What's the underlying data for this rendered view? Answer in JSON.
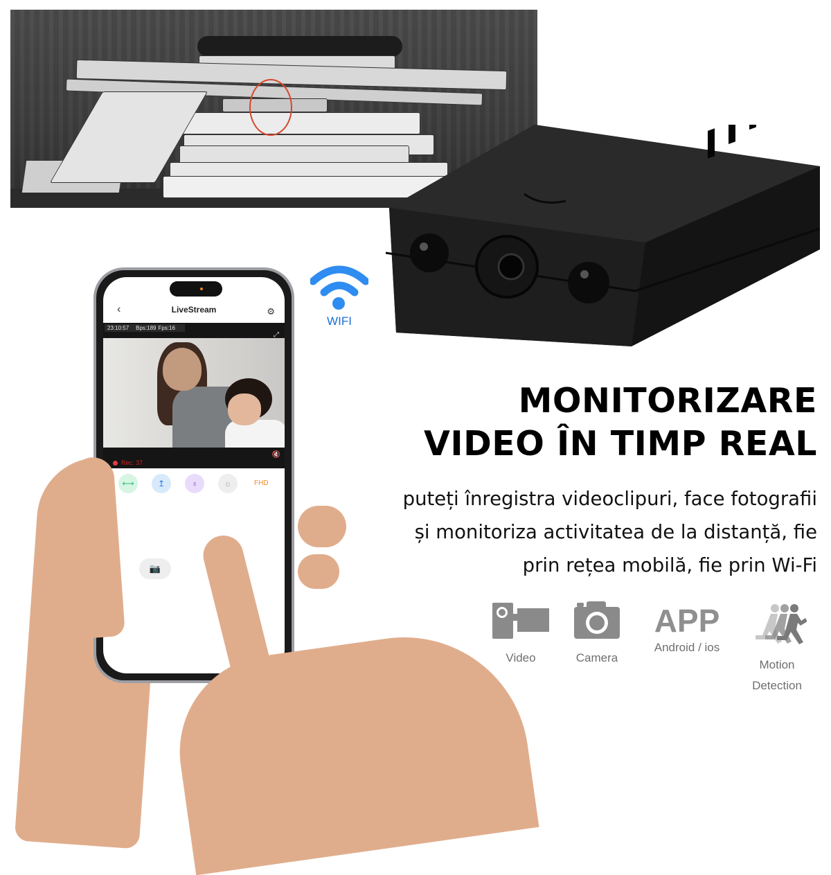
{
  "photo": {
    "description": "stack of books with hidden camera circled"
  },
  "phone_app": {
    "title": "LiveStream",
    "back_icon": "chevron-left-icon",
    "settings_icon": "gear-icon",
    "stream_time": "23:10:57",
    "stream_bps": "Bps:189",
    "stream_fps": "Fps:16",
    "expand_icon": "fullscreen-icon",
    "mute_icon": "speaker-muted-icon",
    "rec_label": "Rec: 37",
    "controls": [
      {
        "name": "horizontal-flip",
        "icon": "⟷",
        "color": "#2fbf71",
        "bg": "#d6f5e3"
      },
      {
        "name": "vertical-flip",
        "icon": "↥",
        "color": "#2b7be0",
        "bg": "#d8e9fb"
      },
      {
        "name": "light",
        "icon": "💡",
        "color": "#8a3fe0",
        "bg": "#e9dcfb"
      },
      {
        "name": "night-mode",
        "icon": "☼",
        "color": "#9a9a9a",
        "bg": "#eeeeee"
      }
    ],
    "quality_label": "FHD",
    "snapshot_icon": "camera-icon"
  },
  "wifi": {
    "label": "WIFI",
    "color": "#1b6fd6"
  },
  "headline": {
    "line1": "MONITORIZARE",
    "line2": "VIDEO ÎN TIMP REAL"
  },
  "subtext": {
    "line1": "puteți înregistra videoclipuri, face fotografii",
    "line2": "și monitoriza activitatea de la distanță, fie",
    "line3": "prin rețea mobilă, fie prin Wi-Fi"
  },
  "features": [
    {
      "icon": "video-camera-icon",
      "label": "Video"
    },
    {
      "icon": "photo-camera-icon",
      "label": "Camera"
    },
    {
      "icon": "app-text-icon",
      "big": "APP",
      "label": "Android / ios"
    },
    {
      "icon": "running-people-icon",
      "label_line1": "Motion",
      "label_line2": "Detection"
    }
  ]
}
